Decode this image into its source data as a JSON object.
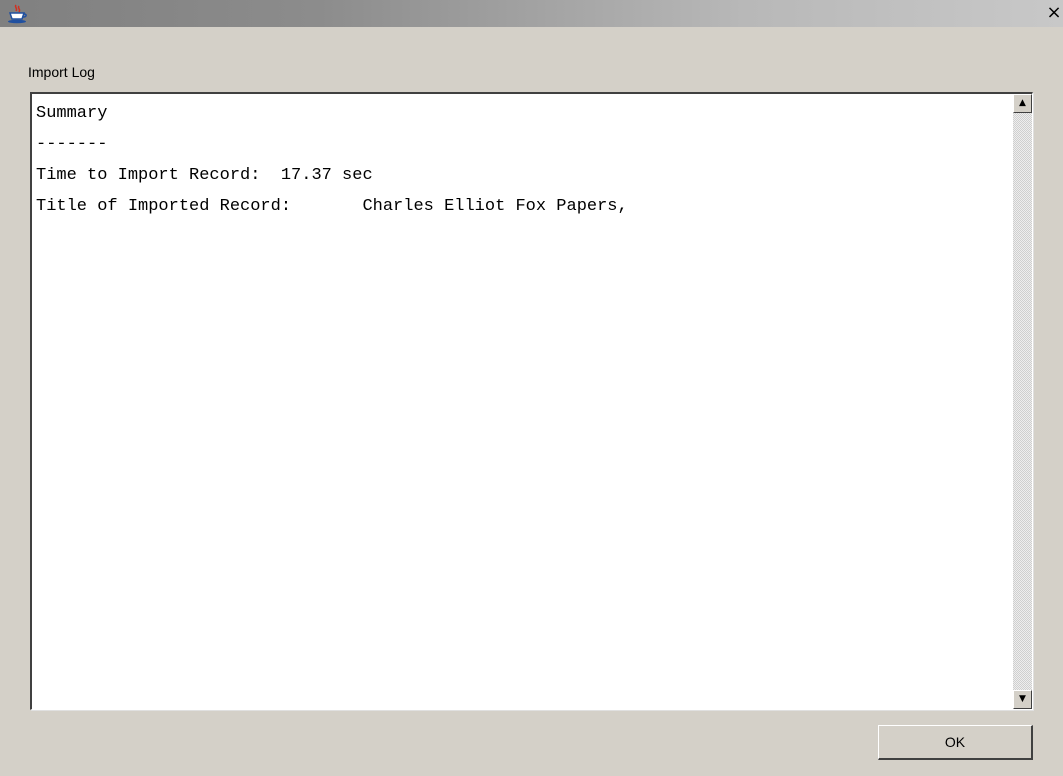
{
  "window": {
    "title": "",
    "icon": "java-coffee-cup-icon",
    "close_glyph": "×"
  },
  "log_panel": {
    "label": "Import Log",
    "lines": [
      "Summary",
      "-------",
      "Time to Import Record:  17.37 sec",
      "Title of Imported Record:       Charles Elliot Fox Papers,"
    ]
  },
  "scrollbar": {
    "up_glyph": "▲",
    "down_glyph": "▼"
  },
  "footer": {
    "ok_label": "OK"
  },
  "colors": {
    "dialog_background": "#d4d0c8",
    "text_area_background": "#ffffff"
  }
}
